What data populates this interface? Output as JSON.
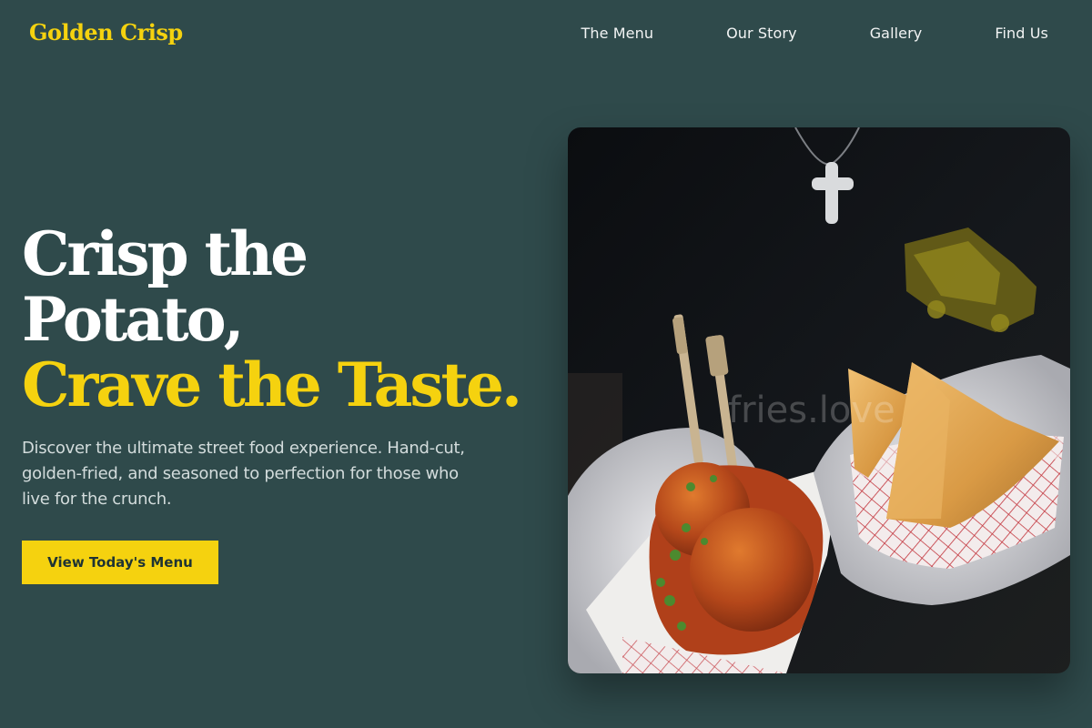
{
  "brand": {
    "name": "Golden Crisp",
    "color": "#f5d20f"
  },
  "nav": {
    "items": [
      {
        "label": "The Menu"
      },
      {
        "label": "Our Story"
      },
      {
        "label": "Gallery"
      },
      {
        "label": "Find Us"
      }
    ]
  },
  "hero": {
    "title_line1": "Crisp the",
    "title_line2": "Potato,",
    "title_accent": "Crave the Taste.",
    "description": "Discover the ultimate street food experience. Hand-cut, golden-fried, and seasoned to perfection for those who live for the crunch.",
    "cta_label": "View Today's Menu"
  },
  "photo": {
    "watermark": "fries.love",
    "subject": "gloved hands holding paper food trays with meatballs in tomato sauce on wooden skewers and fried samosas"
  },
  "colors": {
    "background": "#2f4a4b",
    "accent": "#f5d20f",
    "text_muted": "#d3dcdc"
  }
}
